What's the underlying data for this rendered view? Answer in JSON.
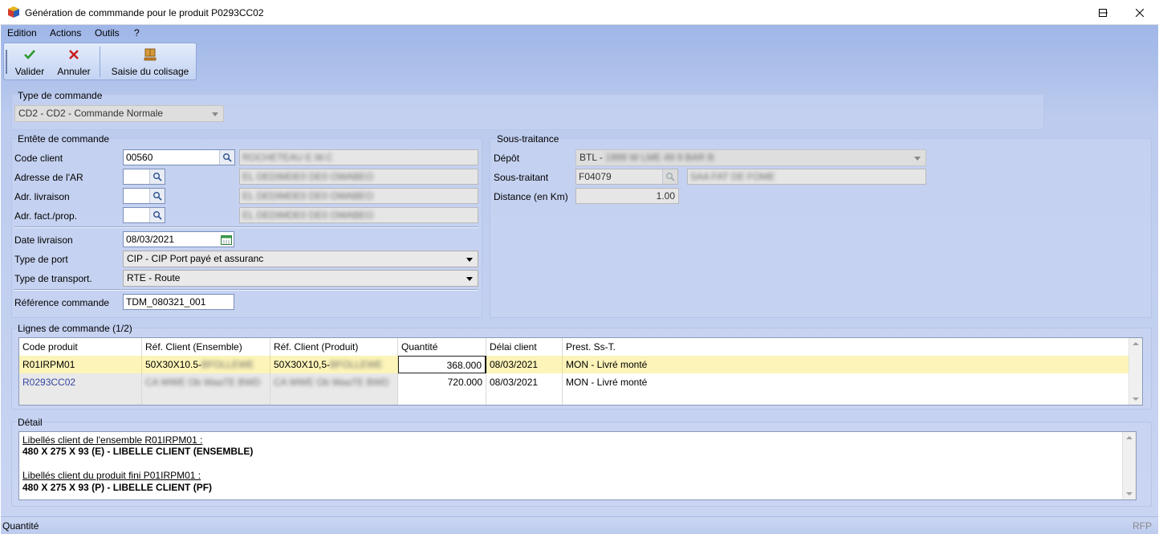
{
  "window": {
    "title": "Génération de commmande pour le produit P0293CC02"
  },
  "menu": [
    "Edition",
    "Actions",
    "Outils",
    "?"
  ],
  "toolbar": {
    "validate_label": "Valider",
    "cancel_label": "Annuler",
    "packing_label": "Saisie du colisage"
  },
  "order_type": {
    "title": "Type de commande",
    "value": "CD2 - CD2 - Commande Normale"
  },
  "header": {
    "title": "Entête de commande",
    "client_code_label": "Code client",
    "client_code": "00560",
    "client_name": "ROCHETEAU E.W.C",
    "ar_address_label": "Adresse de l'AR",
    "ar_address_desc": "EL DEDIMDE0 DE0 OWABEO",
    "delivery_address_label": "Adr. livraison",
    "delivery_address_desc": "EL DEDIMDE0 DE0 OWABEO",
    "billing_address_label": "Adr. fact./prop.",
    "billing_address_desc": "EL DEDIMDE0 DE0 OWABEO",
    "delivery_date_label": "Date livraison",
    "delivery_date": "08/03/2021",
    "port_type_label": "Type de port",
    "port_type": "CIP - CIP Port payé et assuranc",
    "transport_type_label": "Type de transport.",
    "transport_type": "RTE - Route",
    "order_ref_label": "Référence commande",
    "order_ref": "TDM_080321_001"
  },
  "subcontracting": {
    "title": "Sous-traitance",
    "depot_label": "Dépôt",
    "depot": "BTL - ",
    "depot_hidden": "1999 W LME 49 9 BAR B",
    "subcontractor_label": "Sous-traitant",
    "subcontractor_code": "F04079",
    "subcontractor_name": "SAA FAT DE FOME",
    "distance_label": "Distance (en Km)",
    "distance": "1.00"
  },
  "order_lines": {
    "title": "Lignes de commande (1/2)",
    "columns": [
      "Code produit",
      "Réf. Client (Ensemble)",
      "Réf. Client (Produit)",
      "Quantité",
      "Délai client",
      "Prest. Ss-T."
    ],
    "rows": [
      {
        "code": "R01IRPM01",
        "ref_set": "50X30X10.5-",
        "ref_set_hidden": "BFOLLEWE",
        "ref_product": "50X30X10,5-",
        "ref_product_hidden": "BFOLLEWE",
        "qty": "368.000",
        "delay": "08/03/2021",
        "service": "MON - Livré  monté"
      },
      {
        "code": "R0293CC02",
        "ref_set_hidden": "CA WWE Ob WaaTE BWD",
        "ref_product_hidden": "CA WWE Ob WaaTE BWD",
        "qty": "720.000",
        "delay": "08/03/2021",
        "service": "MON - Livré  monté"
      }
    ]
  },
  "detail": {
    "title": "Détail",
    "set_heading": "Libellés client de l'ensemble R01IRPM01 :",
    "set_text": "480 X 275 X 93 (E) - LIBELLE CLIENT (ENSEMBLE)",
    "product_heading": "Libellés client du produit fini P01IRPM01 :",
    "product_text": "480 X 275 X 93 (P) - LIBELLE CLIENT (PF)"
  },
  "status": {
    "left": "Quantité",
    "right": "RFP"
  },
  "colors": {
    "selected_row": "#fcf4b8",
    "background": "#c9d5f2"
  }
}
